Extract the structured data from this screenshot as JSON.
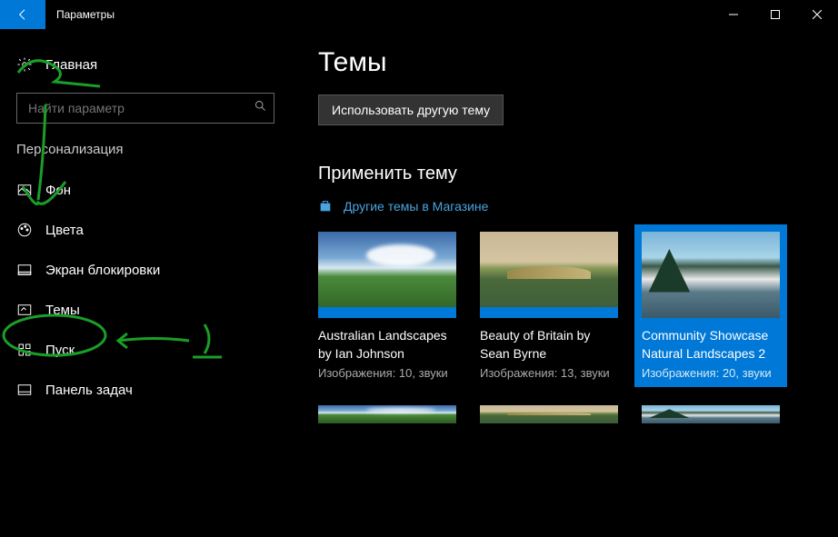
{
  "titlebar": {
    "title": "Параметры"
  },
  "sidebar": {
    "home": "Главная",
    "search_placeholder": "Найти параметр",
    "section": "Персонализация",
    "items": [
      {
        "label": "Фон",
        "icon": "image-icon"
      },
      {
        "label": "Цвета",
        "icon": "palette-icon"
      },
      {
        "label": "Экран блокировки",
        "icon": "lock-icon"
      },
      {
        "label": "Темы",
        "icon": "brush-icon"
      },
      {
        "label": "Пуск",
        "icon": "grid-icon"
      },
      {
        "label": "Панель задач",
        "icon": "taskbar-icon"
      }
    ]
  },
  "main": {
    "title": "Темы",
    "alt_theme_button": "Использовать другую тему",
    "apply_heading": "Применить тему",
    "store_link": "Другие темы в Магазине",
    "themes": [
      {
        "name": "Australian Landscapes by Ian Johnson",
        "meta": "Изображения: 10, звуки",
        "selected": false
      },
      {
        "name": "Beauty of Britain by Sean Byrne",
        "meta": "Изображения: 13, звуки",
        "selected": false
      },
      {
        "name": "Community Showcase Natural Landscapes 2",
        "meta": "Изображения: 20, звуки",
        "selected": true
      }
    ]
  },
  "annotations": {
    "marker_color": "#1a9e28",
    "label1": "1",
    "label2": "2"
  }
}
